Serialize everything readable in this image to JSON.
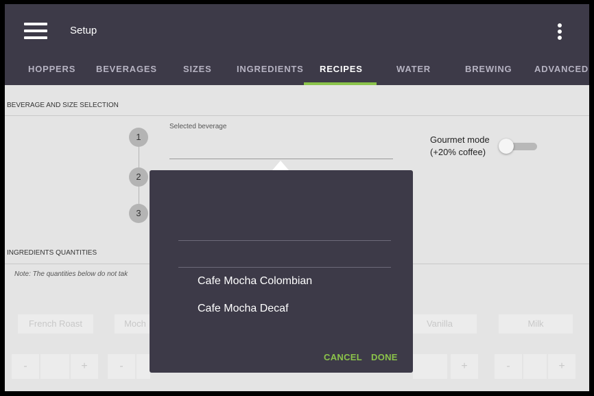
{
  "app": {
    "title": "Setup"
  },
  "icons": {
    "menu": "hamburger-menu-icon",
    "overflow": "more-vert-icon"
  },
  "colors": {
    "accent": "#8bc34a",
    "topbar": "#3d3a48"
  },
  "tabs": [
    {
      "label": "HOPPERS",
      "active": false
    },
    {
      "label": "BEVERAGES",
      "active": false
    },
    {
      "label": "SIZES",
      "active": false
    },
    {
      "label": "INGREDIENTS",
      "active": false
    },
    {
      "label": "RECIPES",
      "active": true
    },
    {
      "label": "WATER",
      "active": false
    },
    {
      "label": "BREWING",
      "active": false
    },
    {
      "label": "ADVANCED",
      "active": false
    }
  ],
  "beverage_section": {
    "heading": "BEVERAGE AND SIZE SELECTION",
    "steps": [
      "1",
      "2",
      "3"
    ],
    "selected_label": "Selected beverage",
    "selected_value": "",
    "gourmet_line1": "Gourmet mode",
    "gourmet_line2": "(+20% coffee)",
    "gourmet_on": false
  },
  "ingredients_section": {
    "heading": "INGREDIENTS QUANTITIES",
    "note": "Note: The quantities below do not tak",
    "items": [
      "French Roast",
      "Moch",
      "Vanilla",
      "Milk"
    ],
    "minus": "-",
    "plus": "+"
  },
  "dialog": {
    "options": [
      "Cafe Mocha Colombian",
      "Cafe Mocha Decaf"
    ],
    "cancel": "CANCEL",
    "done": "DONE"
  }
}
